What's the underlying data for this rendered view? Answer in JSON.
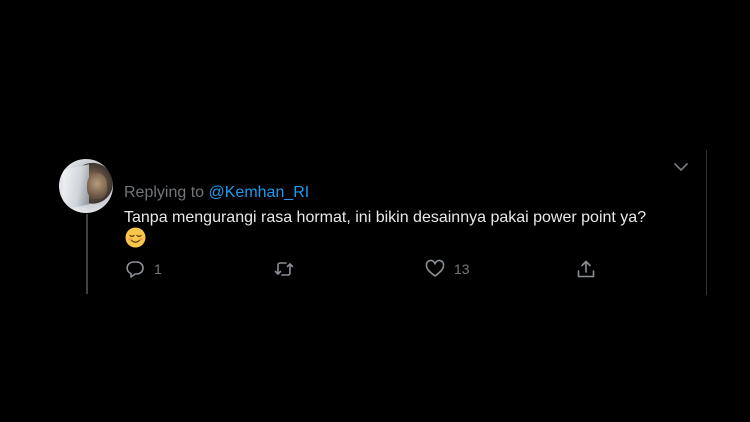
{
  "tweet": {
    "replying_prefix": "Replying to ",
    "replying_handle": "@Kemhan_RI",
    "text": "Tanpa mengurangi rasa hormat, ini bikin desainnya pakai power point ya?",
    "emoji": "relieved-face-emoji",
    "actions": {
      "reply_count": "1",
      "retweet_count": "",
      "like_count": "13"
    },
    "icons": {
      "reply": "reply-icon",
      "retweet": "retweet-icon",
      "like": "heart-icon",
      "share": "share-icon",
      "more": "chevron-down-icon"
    }
  },
  "colors": {
    "background": "#000000",
    "text": "#e7e9ea",
    "muted": "#71767b",
    "link": "#1d9bf0",
    "thread_line": "#3d4145",
    "divider": "#2f3336",
    "emoji": "#f7c64b"
  }
}
